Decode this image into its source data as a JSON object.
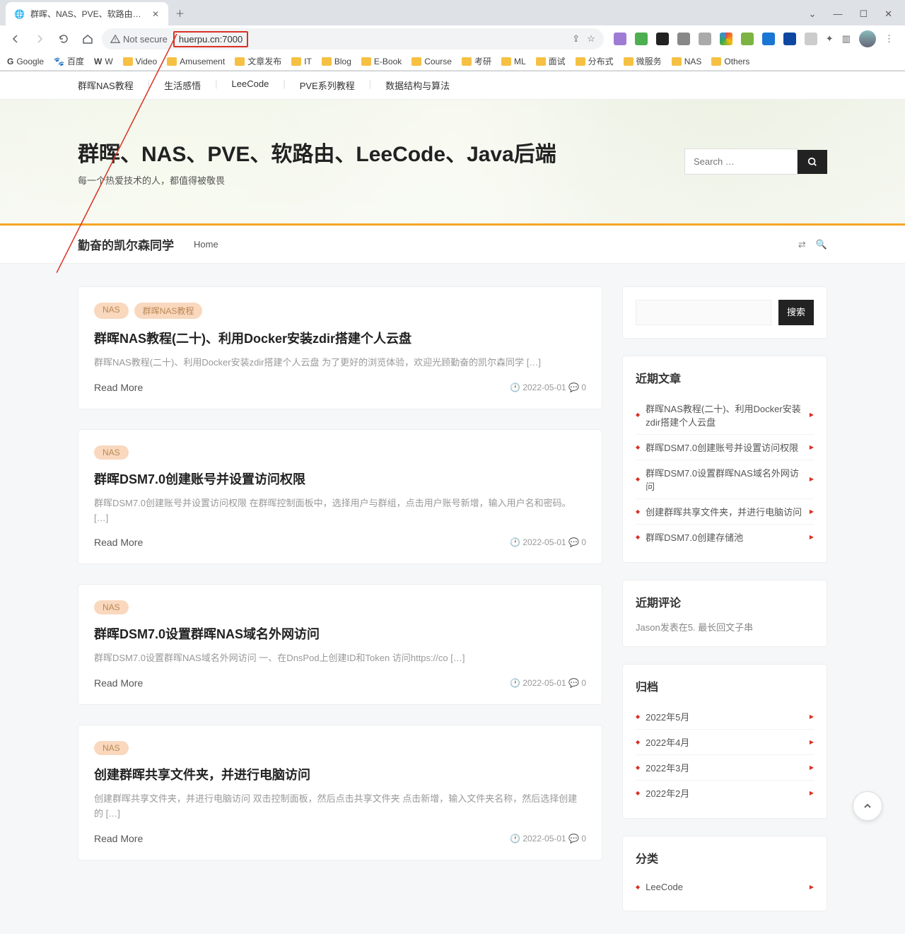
{
  "browser": {
    "tab_title": "群晖、NAS、PVE、软路由、Le…",
    "address": {
      "not_secure": "Not secure",
      "url": "huerpu.cn:7000"
    },
    "bookmarks": [
      "Google",
      "百度",
      "W",
      "Video",
      "Amusement",
      "文章发布",
      "IT",
      "Blog",
      "E-Book",
      "Course",
      "考研",
      "ML",
      "面试",
      "分布式",
      "微服务",
      "NAS",
      "Others"
    ]
  },
  "topnav": [
    "群晖NAS教程",
    "生活感悟",
    "LeeCode",
    "PVE系列教程",
    "数据结构与算法"
  ],
  "hero": {
    "title": "群晖、NAS、PVE、软路由、LeeCode、Java后端",
    "subtitle": "每一个热爱技术的人，都值得被敬畏",
    "search_placeholder": "Search …"
  },
  "sticky": {
    "brand": "勤奋的凯尔森同学",
    "nav": "Home"
  },
  "posts": [
    {
      "tags": [
        "NAS",
        "群晖NAS教程"
      ],
      "title": "群晖NAS教程(二十)、利用Docker安装zdir搭建个人云盘",
      "excerpt": "群晖NAS教程(二十)、利用Docker安装zdir搭建个人云盘 为了更好的浏览体验，欢迎光顾勤奋的凯尔森同学 […]",
      "read_more": "Read More",
      "date": "2022-05-01",
      "comments": "0"
    },
    {
      "tags": [
        "NAS"
      ],
      "title": "群晖DSM7.0创建账号并设置访问权限",
      "excerpt": "群晖DSM7.0创建账号并设置访问权限 在群晖控制面板中，选择用户与群组，点击用户账号新增，输入用户名和密码。 […]",
      "read_more": "Read More",
      "date": "2022-05-01",
      "comments": "0"
    },
    {
      "tags": [
        "NAS"
      ],
      "title": "群晖DSM7.0设置群晖NAS域名外网访问",
      "excerpt": "群晖DSM7.0设置群晖NAS域名外网访问 一、在DnsPod上创建ID和Token 访问https://co […]",
      "read_more": "Read More",
      "date": "2022-05-01",
      "comments": "0"
    },
    {
      "tags": [
        "NAS"
      ],
      "title": "创建群晖共享文件夹，并进行电脑访问",
      "excerpt": "创建群晖共享文件夹，并进行电脑访问 双击控制面板，然后点击共享文件夹 点击新增，输入文件夹名称，然后选择创建的 […]",
      "read_more": "Read More",
      "date": "2022-05-01",
      "comments": "0"
    }
  ],
  "sidebar": {
    "search_btn": "搜索",
    "recent_title": "近期文章",
    "recent": [
      "群晖NAS教程(二十)、利用Docker安装zdir搭建个人云盘",
      "群晖DSM7.0创建账号并设置访问权限",
      "群晖DSM7.0设置群晖NAS域名外网访问",
      "创建群晖共享文件夹，并进行电脑访问",
      "群晖DSM7.0创建存储池"
    ],
    "comments_title": "近期评论",
    "comments_text": "Jason发表在5. 最长回文子串",
    "archive_title": "归档",
    "archives": [
      "2022年5月",
      "2022年4月",
      "2022年3月",
      "2022年2月"
    ],
    "category_title": "分类",
    "categories": [
      "LeeCode"
    ]
  }
}
